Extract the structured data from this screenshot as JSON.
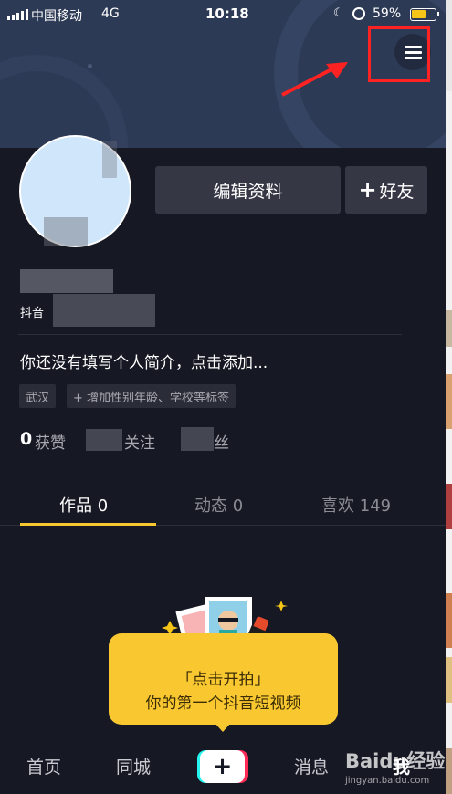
{
  "status_bar": {
    "carrier": "中国移动",
    "network": "4G",
    "time": "10:18",
    "battery": "59%"
  },
  "profile": {
    "id_prefix": "抖音",
    "edit_label": "编辑资料",
    "add_friend_label": "好友",
    "bio": "你还没有填写个人简介，点击添加...",
    "tags": [
      "武汉",
      "+ 增加性别年龄、学校等标签"
    ],
    "stats": {
      "likes_count": "0",
      "likes_label": "获赞",
      "following_label": "关注",
      "fans_label_visible": "丝"
    }
  },
  "tabs": [
    {
      "label": "作品 0",
      "active": true
    },
    {
      "label": "动态 0",
      "active": false
    },
    {
      "label": "喜欢 149",
      "active": false
    }
  ],
  "empty_state": {
    "line1": "「点击开拍」",
    "line2": "你的第一个抖音短视频"
  },
  "bottom_nav": {
    "home": "首页",
    "nearby": "同城",
    "create": "+",
    "messages": "消息",
    "me": "我"
  },
  "watermark": {
    "main": "Baidu经验",
    "sub": "jingyan.baidu.com"
  },
  "colors": {
    "background": "#161823",
    "accent_yellow": "#f9c831",
    "highlight_red": "#ff2222"
  }
}
